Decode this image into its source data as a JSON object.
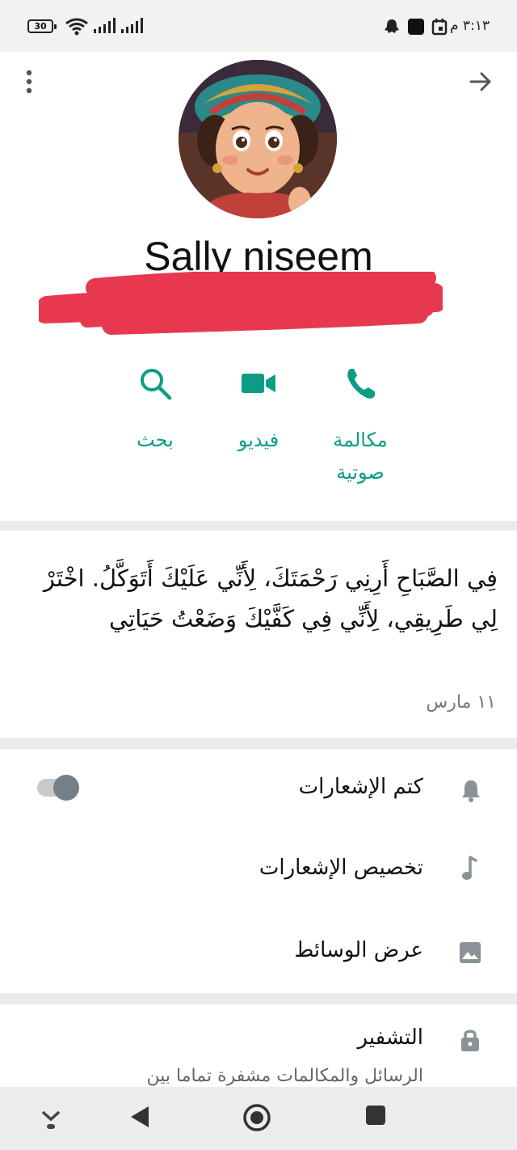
{
  "status_bar": {
    "time": "٣:١٣ م",
    "battery": "30",
    "icons": [
      "wifi-icon",
      "signal-icon",
      "signal-icon",
      "ghost-icon",
      "square-icon",
      "calendar-icon"
    ]
  },
  "header": {
    "back_icon": "arrow-right-icon",
    "menu_icon": "more-vertical-icon"
  },
  "contact": {
    "name": "Sally niseem"
  },
  "actions": [
    {
      "label": "مكالمة صوتية",
      "icon": "phone-icon"
    },
    {
      "label": "فيديو",
      "icon": "video-icon"
    },
    {
      "label": "بحث",
      "icon": "search-icon"
    }
  ],
  "about": {
    "text": "فِي الصَّبَاحِ أَرِنِي رَحْمَتَكَ، لِأَنِّي عَلَيْكَ أَتَوَكَّلُ. اخْتَرْ لِي طَرِيقِي، لِأَنِّي فِي كَفَّيْكَ وَضَعْتُ حَيَاتِي",
    "date": "١١ مارس"
  },
  "settings": [
    {
      "label": "كتم الإشعارات",
      "icon": "bell-icon",
      "toggle": false
    },
    {
      "label": "تخصيص الإشعارات",
      "icon": "music-note-icon"
    },
    {
      "label": "عرض الوسائط",
      "icon": "image-icon"
    }
  ],
  "encryption": {
    "title": "التشفير",
    "subtitle": "الرسائل والمكالمات مشفرة تماما بين",
    "icon": "lock-icon"
  },
  "colors": {
    "accent": "#0b9e84",
    "redaction": "#e6394f",
    "icon_gray": "#8a9298"
  },
  "nav_bar": {
    "icons": [
      "chevron-down-icon",
      "back-triangle-icon",
      "home-circle-icon",
      "recents-square-icon"
    ]
  }
}
